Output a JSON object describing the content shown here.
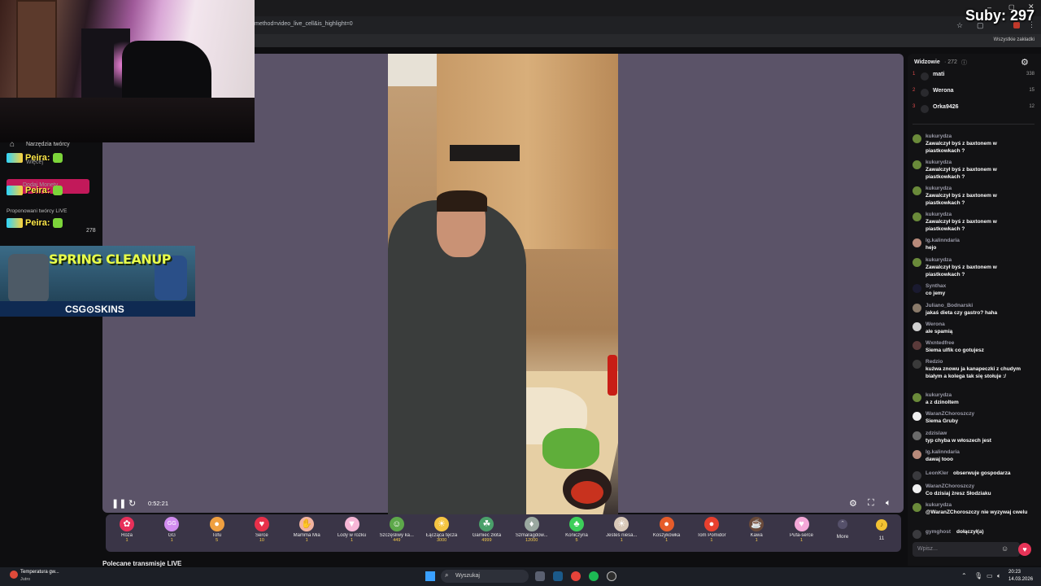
{
  "browser": {
    "url_fragment": "method=video_live_cell&is_highlight=0",
    "bookmarks_all": "Wszystkie zakładki"
  },
  "overlay": {
    "subs": "Suby: 297"
  },
  "sidebar": {
    "creator_tools": "Narzędzia twórcy",
    "more": "Więcej",
    "coins": "Dodaj Monety",
    "recommended": "Proponowani twórcy LIVE",
    "count": "278",
    "peira_label": "Peira:"
  },
  "ad": {
    "title": "SPRING CLEANUP",
    "brand": "CSG⊙SKINS"
  },
  "player": {
    "time": "0:52:21"
  },
  "gifts": [
    {
      "name": "Róża",
      "price": "1",
      "icon": "rose-icon",
      "color": "#e8305a",
      "glyph": "✿"
    },
    {
      "name": "GG",
      "price": "1",
      "icon": "gg-icon",
      "color": "#d18cf0",
      "glyph": "GG"
    },
    {
      "name": "Tofu",
      "price": "5",
      "icon": "tofu-icon",
      "color": "#f0a040",
      "glyph": "●"
    },
    {
      "name": "Serce",
      "price": "10",
      "icon": "heart-icon",
      "color": "#e8304a",
      "glyph": "♥"
    },
    {
      "name": "Mamma Mia",
      "price": "1",
      "icon": "hand-icon",
      "color": "#f3b3a0",
      "glyph": "✋"
    },
    {
      "name": "Lody w rożku",
      "price": "1",
      "icon": "ice-cream-icon",
      "color": "#f6b6d6",
      "glyph": "▼"
    },
    {
      "name": "Szczęśliwy ka...",
      "price": "449",
      "icon": "lucky-cat-icon",
      "color": "#5da84a",
      "glyph": "☺"
    },
    {
      "name": "Łącząca tęcza",
      "price": "3000",
      "icon": "rainbow-icon",
      "color": "#f5c542",
      "glyph": "☀"
    },
    {
      "name": "Garniec złota",
      "price": "4999",
      "icon": "pot-of-gold-icon",
      "color": "#4aa06a",
      "glyph": "☘"
    },
    {
      "name": "Szmaragdow...",
      "price": "12000",
      "icon": "emerald-icon",
      "color": "#9aa8a0",
      "glyph": "♦"
    },
    {
      "name": "Koniczyna",
      "price": "5",
      "icon": "clover-icon",
      "color": "#3ccf5a",
      "glyph": "♣"
    },
    {
      "name": "Jesteś niesa...",
      "price": "1",
      "icon": "cat-icon",
      "color": "#d8c8b8",
      "glyph": "☀"
    },
    {
      "name": "Koszykówka",
      "price": "1",
      "icon": "basketball-icon",
      "color": "#e65c2a",
      "glyph": "●"
    },
    {
      "name": "Tom Pomidor",
      "price": "1",
      "icon": "tomato-icon",
      "color": "#e8402e",
      "glyph": "●"
    },
    {
      "name": "Kawa",
      "price": "1",
      "icon": "coffee-icon",
      "color": "#6a4a3a",
      "glyph": "☕"
    },
    {
      "name": "Pufa-serce",
      "price": "1",
      "icon": "puffy-heart-icon",
      "color": "#f4a8d8",
      "glyph": "♥"
    }
  ],
  "gifts_more": "More",
  "coins_balance": "11",
  "recommended_live": "Polecane transmisje LIVE",
  "chat": {
    "viewers_title": "Widzowie",
    "viewers_count": "· 272",
    "top_viewers": [
      {
        "rank": "1",
        "name": "mati",
        "score": "338"
      },
      {
        "rank": "2",
        "name": "Werona",
        "score": "15"
      },
      {
        "rank": "3",
        "name": "Orka9426",
        "score": "12"
      }
    ],
    "messages": [
      {
        "user": "kukurydza",
        "text": "Zawalczył byś z baxtonem w piastkowkach ?",
        "avatar": "#6a8a3a"
      },
      {
        "user": "kukurydza",
        "text": "Zawalczył byś z baxtonem w piastkowkach ?",
        "avatar": "#6a8a3a"
      },
      {
        "user": "kukurydza",
        "text": "Zawalczył byś z baxtonem w piastkowkach ?",
        "avatar": "#6a8a3a"
      },
      {
        "user": "kukurydza",
        "text": "Zawalczył byś z baxtonem w piastkowkach ?",
        "avatar": "#6a8a3a"
      },
      {
        "user": "lg.kalinndaria",
        "text": "hejo",
        "avatar": "#b88a7a"
      },
      {
        "user": "kukurydza",
        "text": "Zawalczył byś z baxtonem w piastkowkach ?",
        "avatar": "#6a8a3a"
      },
      {
        "user": "Synthax",
        "text": "co jemy",
        "avatar": "#1a1a30"
      },
      {
        "user": "Juliano_Bodnarski",
        "text": "jakaś dieta czy gastro? haha",
        "avatar": "#8a7a6a"
      },
      {
        "user": "Werona",
        "text": "ale spamią",
        "avatar": "#d0d0d0"
      },
      {
        "user": "Wxntedfree",
        "text": "Siema ulfik co gotujesz",
        "avatar": "#5a3a3a"
      },
      {
        "user": "Redzio",
        "text": "kuźwa znowu ja kanapeczki z chudym białym a kolega tak się stołuje :/",
        "avatar": "#3a3a3a"
      },
      {
        "user": "kukurydza",
        "text": "a z dzinoltem",
        "avatar": "#6a8a3a"
      },
      {
        "user": "WaranZChoroszczy",
        "text": "Siema Gruby",
        "avatar": "#f0f0f0"
      },
      {
        "user": "zdzislaw",
        "text": "typ chyba w włoszech jest",
        "avatar": "#6a6a6a"
      },
      {
        "user": "lg.kalinndaria",
        "text": "dawaj tooo",
        "avatar": "#b88a7a"
      }
    ],
    "follow_event": {
      "user": "LeonKler",
      "text": "obserwuje gospodarza"
    },
    "messages2": [
      {
        "user": "WaranZChoroszczy",
        "text": "Co dzisiaj żresz Słodziaku",
        "avatar": "#f0f0f0"
      },
      {
        "user": "kukurydza",
        "text": "@WaranZChoroszczy nie wyzywaj cwelu",
        "avatar": "#6a8a3a"
      }
    ],
    "join_event": {
      "user": "gymghost",
      "text": "dołączył(a)"
    },
    "input_placeholder": "Wpisz..."
  },
  "taskbar": {
    "weather_title": "Temperatura gw...",
    "weather_sub": "Jutro",
    "search": "Wyszukaj",
    "time": "20:23",
    "date": "14.03.2026"
  }
}
